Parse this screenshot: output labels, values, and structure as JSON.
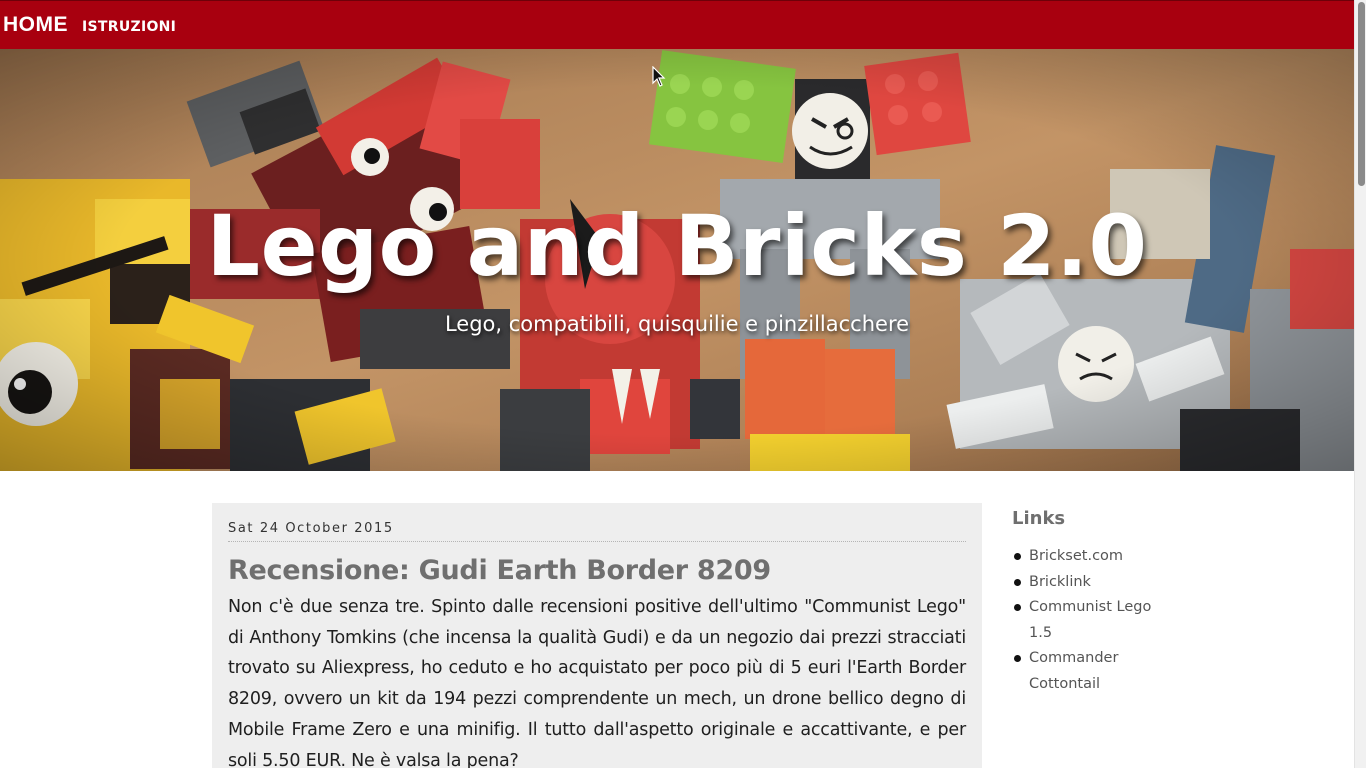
{
  "nav": {
    "home": "HOME",
    "links": [
      "ISTRUZIONI"
    ]
  },
  "hero": {
    "title": "Lego and Bricks 2.0",
    "subtitle": "Lego, compatibili, quisquilie e pinzillacchere"
  },
  "post": {
    "date": "Sat 24 October 2015",
    "title": "Recensione: Gudi Earth Border 8209",
    "body": "Non c'è due senza tre. Spinto dalle recensioni positive dell'ultimo \"Communist Lego\" di Anthony Tomkins (che incensa la qualità Gudi) e da un negozio dai prezzi stracciati trovato su Aliexpress, ho ceduto e ho acquistato per poco più di 5 euri l'Earth Border 8209, ovvero un kit da 194 pezzi comprendente un mech, un drone bellico degno di Mobile Frame Zero e una minifig. Il tutto dall'aspetto originale e accattivante, e per soli 5.50 EUR. Ne è valsa la pena?"
  },
  "sidebar": {
    "title": "Links",
    "links": [
      "Brickset.com",
      "Bricklink",
      "Communist Lego 1.5",
      "Commander Cottontail"
    ]
  },
  "colors": {
    "navbar": "#a8000f",
    "article_bg": "#eeeeee",
    "heading_gray": "#6f6f6f"
  },
  "icons": {
    "cursor": "mouse-pointer-icon"
  }
}
